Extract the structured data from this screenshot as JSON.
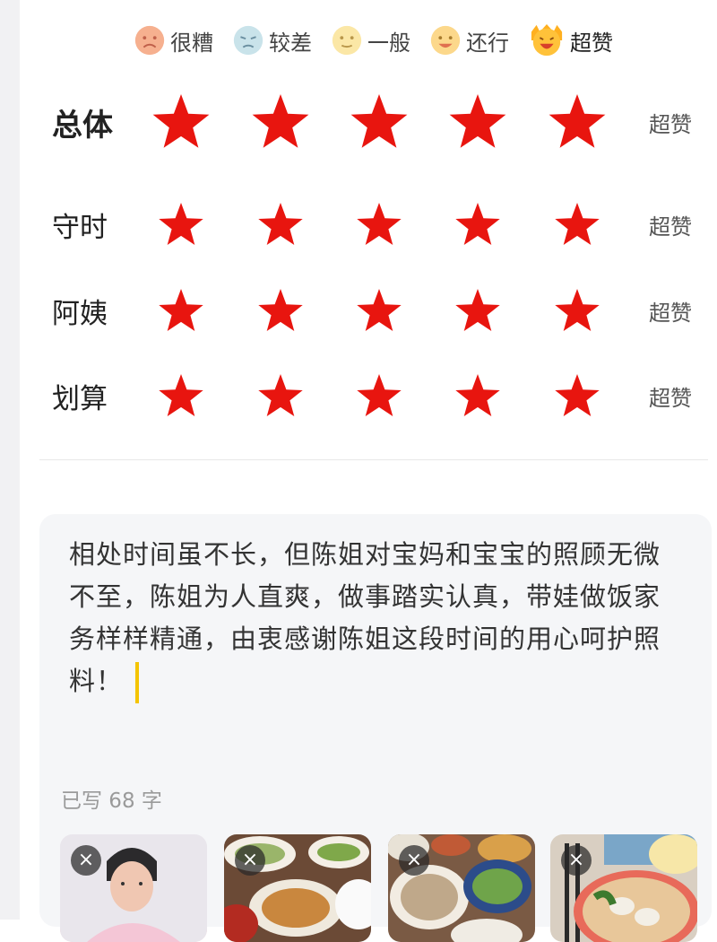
{
  "legend": [
    {
      "label": "很糟",
      "face": "very-bad-face-icon",
      "color": "#f6b08f"
    },
    {
      "label": "较差",
      "face": "bad-face-icon",
      "color": "#c9e3ea"
    },
    {
      "label": "一般",
      "face": "neutral-face-icon",
      "color": "#fbe7a6"
    },
    {
      "label": "还行",
      "face": "ok-face-icon",
      "color": "#fcd88b"
    },
    {
      "label": "超赞",
      "face": "great-face-icon",
      "color": "#ffc23a"
    }
  ],
  "ratings": [
    {
      "label": "总体",
      "stars": 5,
      "max": 5,
      "value": "超赞"
    },
    {
      "label": "守时",
      "stars": 5,
      "max": 5,
      "value": "超赞"
    },
    {
      "label": "阿姨",
      "stars": 5,
      "max": 5,
      "value": "超赞"
    },
    {
      "label": "划算",
      "stars": 5,
      "max": 5,
      "value": "超赞"
    }
  ],
  "comment": {
    "text": "相处时间虽不长，但陈姐对宝妈和宝宝的照顾无微不至，陈姐为人直爽，做事踏实认真，带娃做饭家务样样精通，由衷感谢陈姐这段时间的用心呵护照料！",
    "char_count": "已写 68 字"
  },
  "photos": [
    {
      "name": "photo-person",
      "remove": "×"
    },
    {
      "name": "photo-dishes-1",
      "remove": "×"
    },
    {
      "name": "photo-dishes-2",
      "remove": "×"
    },
    {
      "name": "photo-dumpling-soup",
      "remove": "×"
    }
  ],
  "colors": {
    "star": "#e8150f",
    "caret": "#f4c400",
    "box_bg": "#f5f6f8"
  }
}
